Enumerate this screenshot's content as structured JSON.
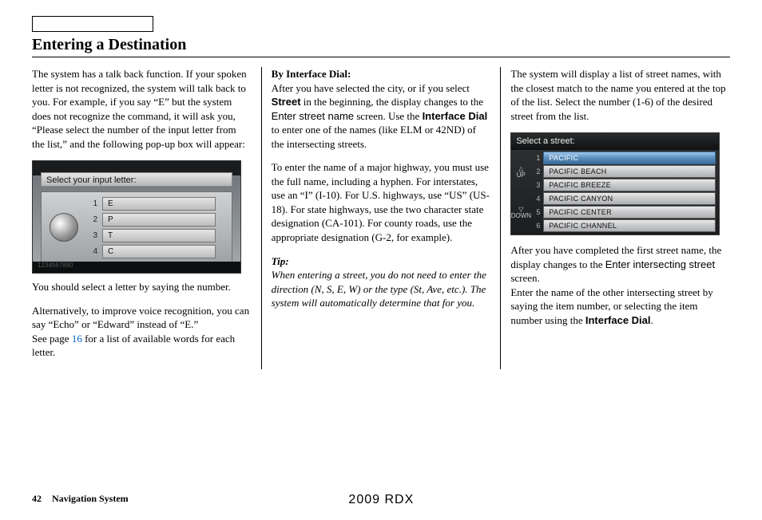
{
  "header": {
    "title": "Entering a Destination"
  },
  "col1": {
    "para1": "The system has a talk back function. If your spoken letter is not recognized, the system will talk back to you. For example, if you say “E” but the system does not recognize the command, it will ask you, “Please select the number of the input letter from the list,” and the following pop-up box will appear:",
    "screenshot": {
      "title": "Select your input letter:",
      "rows": [
        {
          "num": "1",
          "letter": "E"
        },
        {
          "num": "2",
          "letter": "P"
        },
        {
          "num": "3",
          "letter": "T"
        },
        {
          "num": "4",
          "letter": "C"
        }
      ],
      "bottom": "1234567890"
    },
    "para2": "You should select a letter by saying the number.",
    "para3a": "Alternatively, to improve voice recognition, you can say “Echo” or “Edward” instead of “E.”",
    "para3b_pre": "See page ",
    "para3b_link": "16",
    "para3b_post": " for a list of available words for each letter."
  },
  "col2": {
    "heading": "By Interface Dial:",
    "p1a": "After you have selected the city, or if you select ",
    "p1_street": "Street",
    "p1b": " in the beginning, the display changes to the ",
    "p1_enter": "Enter street name",
    "p1c": " screen. Use the ",
    "p1_dial": "Interface Dial",
    "p1d": " to enter one of the names (like ELM or 42ND) of the intersecting streets.",
    "p2": "To enter the name of a major highway, you must use the full name, including a hyphen. For interstates, use an “I” (I-10). For U.S. highways, use “US” (US-18). For state highways, use the two character state designation (CA-101). For county roads, use the appropriate designation (G-2, for example).",
    "tip_label": "Tip:",
    "tip_body": "When entering a street, you do not need to enter the direction (N, S, E, W) or the type (St, Ave, etc.). The system will automatically determine that for you."
  },
  "col3": {
    "p1": "The system will display a list of street names, with the closest match to the name you entered at the top of the list. Select the number (1-6) of the desired street from the list.",
    "screenshot": {
      "title": "Select a street:",
      "up": "△",
      "up_label": "UP",
      "down": "▽",
      "down_label": "DOWN",
      "rows": [
        {
          "num": "1",
          "name": "PACIFIC",
          "sel": true
        },
        {
          "num": "2",
          "name": "PACIFIC BEACH",
          "sel": false
        },
        {
          "num": "3",
          "name": "PACIFIC BREEZE",
          "sel": false
        },
        {
          "num": "4",
          "name": "PACIFIC CANYON",
          "sel": false
        },
        {
          "num": "5",
          "name": "PACIFIC CENTER",
          "sel": false
        },
        {
          "num": "6",
          "name": "PACIFIC CHANNEL",
          "sel": false
        }
      ]
    },
    "p2a": "After you have completed the first street name, the display changes to the ",
    "p2_enter": "Enter intersecting street",
    "p2b": " screen.",
    "p3a": "Enter the name of the other intersecting street by saying the item number, or selecting the item number using the ",
    "p3_dial": "Interface Dial",
    "p3b": "."
  },
  "footer": {
    "page": "42",
    "section": "Navigation System",
    "model": "2009  RDX"
  }
}
